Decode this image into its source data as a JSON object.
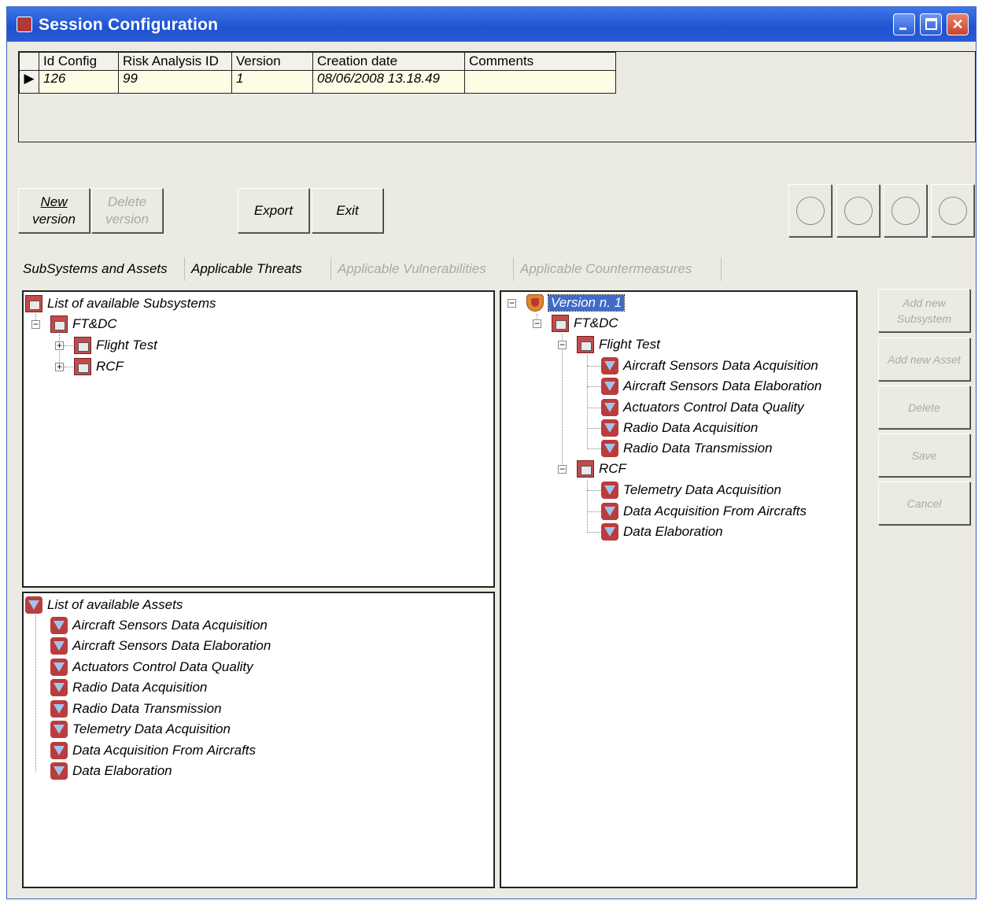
{
  "window": {
    "title": "Session Configuration",
    "colors": {
      "titlebar": "#2458d4",
      "face": "#ecebe3",
      "selection": "#3f6bc9",
      "disabled_text": "#a9a9a9"
    }
  },
  "grid": {
    "columns": [
      "Id Config",
      "Risk Analysis ID",
      "Version",
      "Creation date",
      "Comments"
    ],
    "rows": [
      {
        "marker": "▶",
        "cells": [
          "126",
          "99",
          "1",
          "08/06/2008 13.18.49",
          ""
        ]
      }
    ]
  },
  "toolbar": {
    "new_version": {
      "line1": "New",
      "line2": "version"
    },
    "delete_version": {
      "line1": "Delete",
      "line2": "version"
    },
    "export": "Export",
    "exit": "Exit"
  },
  "tabs": [
    "SubSystems and Assets",
    "Applicable Threats",
    "Applicable Vulnerabilities",
    "Applicable Countermeasures"
  ],
  "subsystems_tree": {
    "root": "List of available Subsystems",
    "group": "FT&DC",
    "children": [
      "Flight Test",
      "RCF"
    ]
  },
  "assets_list": {
    "root": "List of available Assets",
    "items": [
      "Aircraft Sensors Data Acquisition",
      "Aircraft Sensors Data Elaboration",
      "Actuators Control Data Quality",
      "Radio Data Acquisition",
      "Radio Data Transmission",
      "Telemetry Data Acquisition",
      "Data Acquisition From Aircrafts",
      "Data Elaboration"
    ]
  },
  "version_tree": {
    "root": "Version n. 1",
    "group": "FT&DC",
    "subsystems": [
      {
        "name": "Flight Test",
        "assets": [
          "Aircraft Sensors Data Acquisition",
          "Aircraft Sensors Data Elaboration",
          "Actuators Control Data Quality",
          "Radio Data Acquisition",
          "Radio Data Transmission"
        ]
      },
      {
        "name": "RCF",
        "assets": [
          "Telemetry Data Acquisition",
          "Data Acquisition From Aircrafts",
          "Data Elaboration"
        ]
      }
    ]
  },
  "side_buttons": {
    "add_subsystem": {
      "line1": "Add new",
      "line2": "Subsystem"
    },
    "add_asset": "Add new Asset",
    "delete": "Delete",
    "save": "Save",
    "cancel": "Cancel"
  },
  "icons": {
    "subsystem": "building-icon",
    "asset": "diamond-asset-icon",
    "version": "shield-icon",
    "expand": "plus-box-icon",
    "collapse": "minus-box-icon"
  }
}
